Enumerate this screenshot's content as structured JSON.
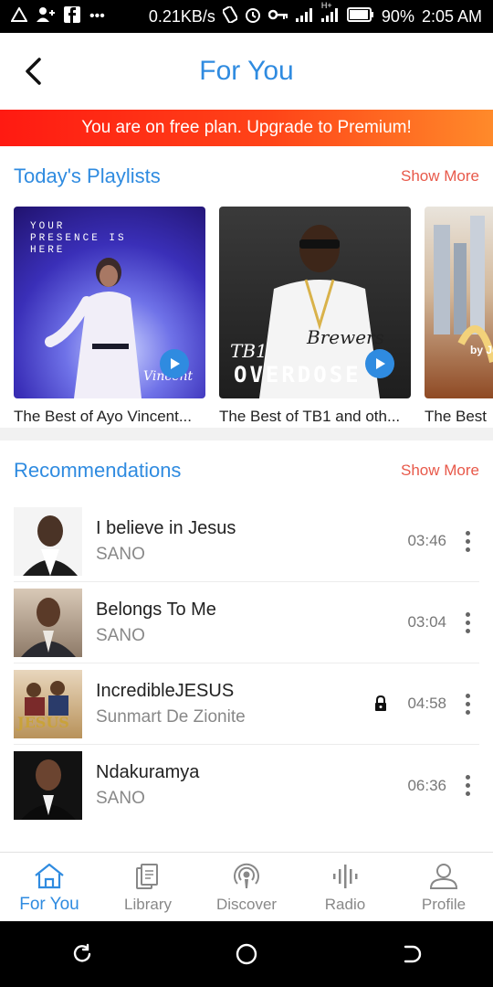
{
  "status_bar": {
    "speed": "0.21KB/s",
    "network_label": "H+",
    "battery": "90%",
    "time": "2:05 AM"
  },
  "header": {
    "title": "For You"
  },
  "banner": {
    "text": "You are on free plan. Upgrade to Premium!"
  },
  "playlists_section": {
    "title": "Today's Playlists",
    "show_more": "Show More",
    "items": [
      {
        "title": "The Best of Ayo Vincent...",
        "cover_text": "YOUR PRESENCE IS HERE",
        "cover_sig": "Vincent"
      },
      {
        "title": "The Best of TB1 and oth...",
        "cover_text": "OVERDOSE",
        "cover_sig": "TB1"
      },
      {
        "title": "The Best",
        "cover_text": "by Jo"
      }
    ]
  },
  "recommendations_section": {
    "title": "Recommendations",
    "show_more": "Show More",
    "items": [
      {
        "title": "I believe in Jesus",
        "artist": "SANO",
        "duration": "03:46",
        "locked": false
      },
      {
        "title": "Belongs To Me",
        "artist": "SANO",
        "duration": "03:04",
        "locked": false
      },
      {
        "title": "IncredibleJESUS",
        "artist": "Sunmart De Zionite",
        "duration": "04:58",
        "locked": true,
        "cover_text": "JESUS"
      },
      {
        "title": "Ndakuramya",
        "artist": "SANO",
        "duration": "06:36",
        "locked": false
      }
    ]
  },
  "bottom_nav": {
    "items": [
      {
        "label": "For You",
        "icon": "home-icon",
        "active": true
      },
      {
        "label": "Library",
        "icon": "library-icon",
        "active": false
      },
      {
        "label": "Discover",
        "icon": "podcast-icon",
        "active": false
      },
      {
        "label": "Radio",
        "icon": "waveform-icon",
        "active": false
      },
      {
        "label": "Profile",
        "icon": "person-icon",
        "active": false
      }
    ]
  },
  "colors": {
    "accent": "#2f8be0",
    "show_more": "#e8594a",
    "banner_start": "#ff1a12",
    "banner_end": "#ff8a2a"
  }
}
